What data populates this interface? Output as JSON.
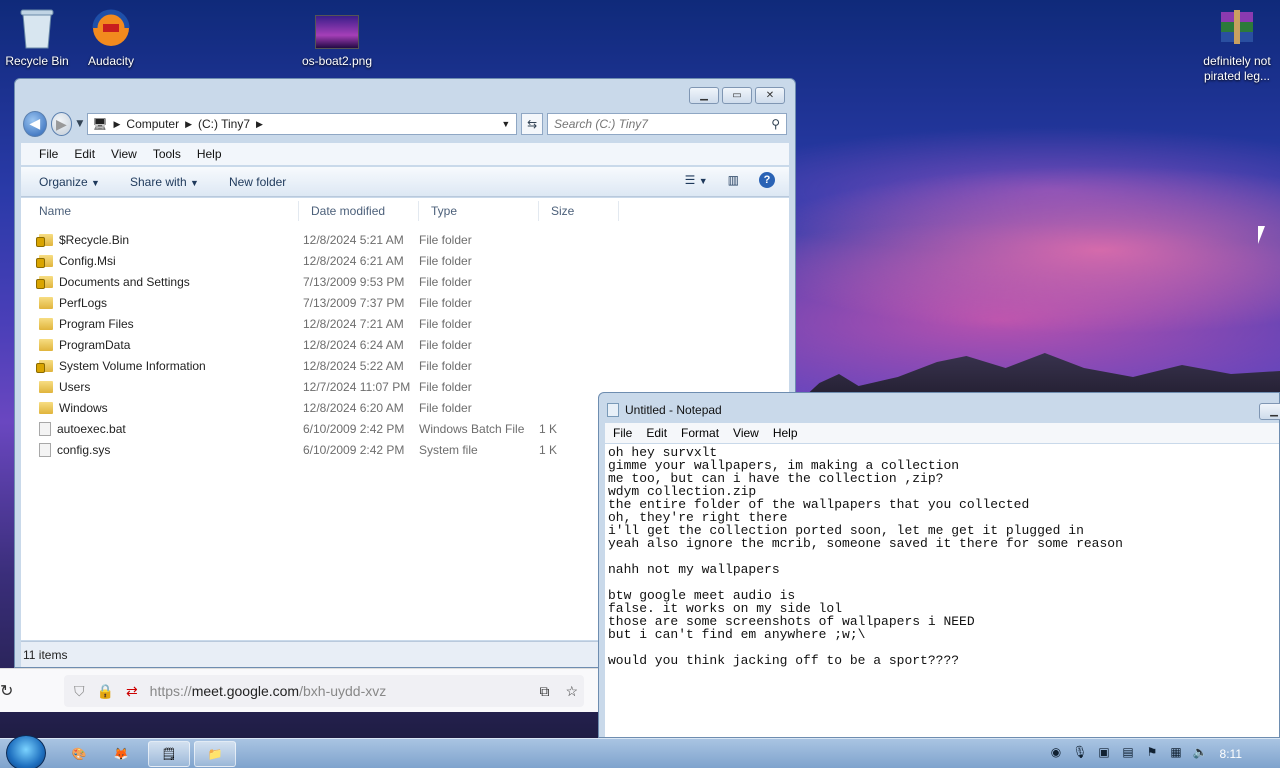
{
  "desktop": {
    "icons": [
      {
        "label": "Recycle Bin"
      },
      {
        "label": "Audacity"
      },
      {
        "label": "os-boat2.png"
      },
      {
        "label": "definitely not pirated leg..."
      }
    ]
  },
  "explorer": {
    "breadcrumb": [
      "Computer",
      "(C:) Tiny7"
    ],
    "search_placeholder": "Search (C:) Tiny7",
    "menu": [
      "File",
      "Edit",
      "View",
      "Tools",
      "Help"
    ],
    "toolbar": {
      "organize": "Organize",
      "share_with": "Share with",
      "new_folder": "New folder"
    },
    "columns": [
      "Name",
      "Date modified",
      "Type",
      "Size"
    ],
    "rows": [
      {
        "name": "$Recycle.Bin",
        "date": "12/8/2024 5:21 AM",
        "type": "File folder",
        "size": "",
        "icon": "locked-folder-icon"
      },
      {
        "name": "Config.Msi",
        "date": "12/8/2024 6:21 AM",
        "type": "File folder",
        "size": "",
        "icon": "locked-folder-icon"
      },
      {
        "name": "Documents and Settings",
        "date": "7/13/2009 9:53 PM",
        "type": "File folder",
        "size": "",
        "icon": "locked-folder-icon"
      },
      {
        "name": "PerfLogs",
        "date": "7/13/2009 7:37 PM",
        "type": "File folder",
        "size": "",
        "icon": "folder-icon"
      },
      {
        "name": "Program Files",
        "date": "12/8/2024 7:21 AM",
        "type": "File folder",
        "size": "",
        "icon": "folder-icon"
      },
      {
        "name": "ProgramData",
        "date": "12/8/2024 6:24 AM",
        "type": "File folder",
        "size": "",
        "icon": "folder-icon"
      },
      {
        "name": "System Volume Information",
        "date": "12/8/2024 5:22 AM",
        "type": "File folder",
        "size": "",
        "icon": "locked-folder-icon"
      },
      {
        "name": "Users",
        "date": "12/7/2024 11:07 PM",
        "type": "File folder",
        "size": "",
        "icon": "folder-icon"
      },
      {
        "name": "Windows",
        "date": "12/8/2024 6:20 AM",
        "type": "File folder",
        "size": "",
        "icon": "folder-icon"
      },
      {
        "name": "autoexec.bat",
        "date": "6/10/2009 2:42 PM",
        "type": "Windows Batch File",
        "size": "1 K",
        "icon": "batch-file-icon"
      },
      {
        "name": "config.sys",
        "date": "6/10/2009 2:42 PM",
        "type": "System file",
        "size": "1 K",
        "icon": "system-file-icon"
      }
    ],
    "status": "11 items"
  },
  "browser": {
    "url_prefix": "https://",
    "url_host": "meet.google.com",
    "url_path": "/bxh-uydd-xvz"
  },
  "notepad": {
    "title": "Untitled - Notepad",
    "menu": [
      "File",
      "Edit",
      "Format",
      "View",
      "Help"
    ],
    "text": "oh hey survxlt\ngimme your wallpapers, im making a collection\nme too, but can i have the collection ,zip?\nwdym collection.zip\nthe entire folder of the wallpapers that you collected\noh, they're right there\ni'll get the collection ported soon, let me get it plugged in\nyeah also ignore the mcrib, someone saved it there for some reason\n\nnahh not my wallpapers\n\nbtw google meet audio is\nfalse. it works on my side lol\nthose are some screenshots of wallpapers i NEED\nbut i can't find em anywhere ;w;\\\n\nwould you think jacking off to be a sport????\n"
  },
  "taskbar": {
    "clock": "8:11"
  }
}
